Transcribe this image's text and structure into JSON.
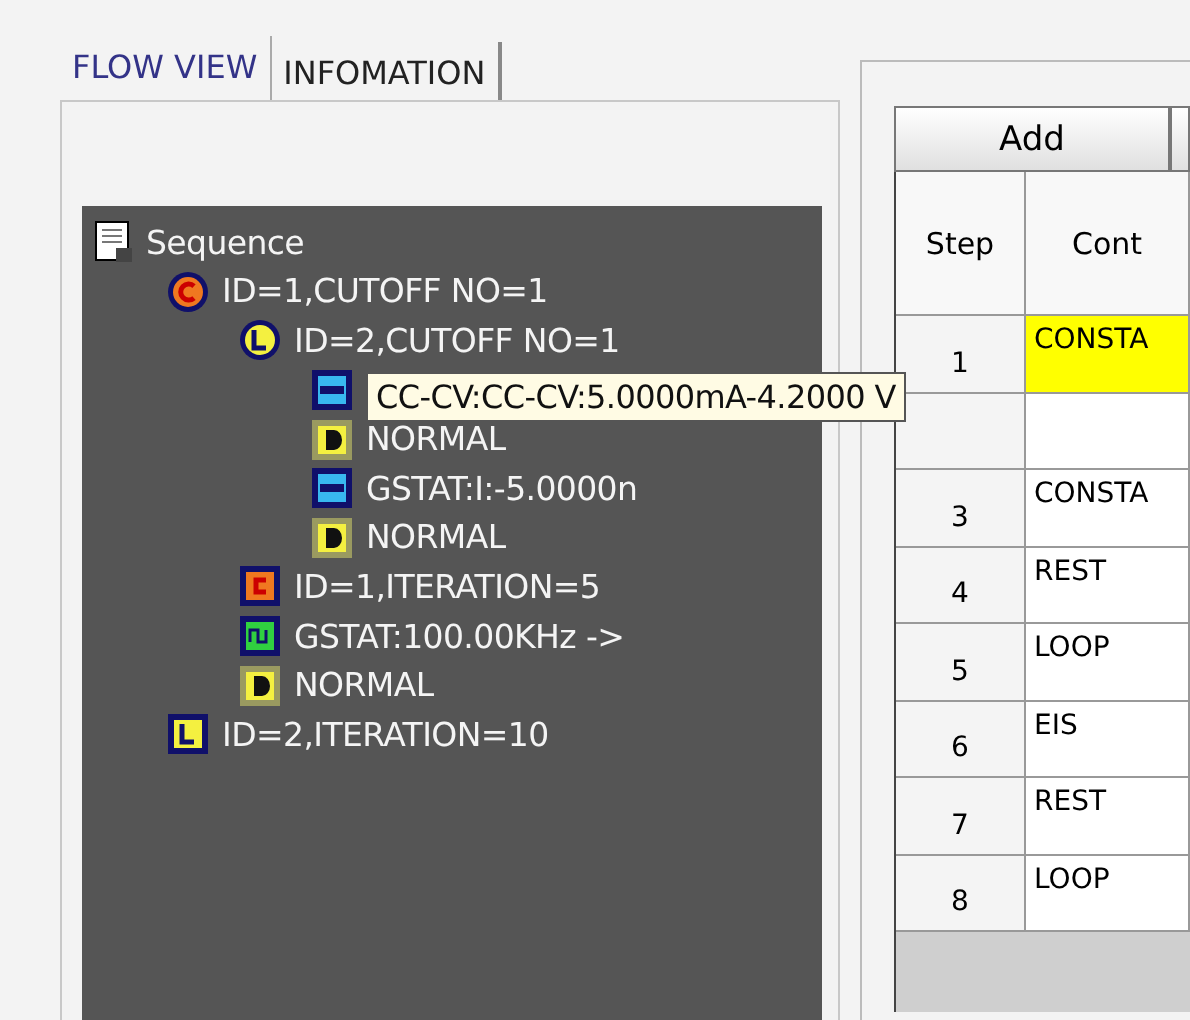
{
  "tabs": [
    {
      "label": "FLOW VIEW",
      "selected": true
    },
    {
      "label": "INFOMATION",
      "selected": false
    }
  ],
  "tree": [
    {
      "kind": "document",
      "label": "Sequence",
      "children": [
        {
          "kind": "cutoff",
          "label": "ID=1,CUTOFF NO=1",
          "children": [
            {
              "kind": "cutoff_loop",
              "label": "ID=2,CUTOFF NO=1",
              "children": [
                {
                  "kind": "step",
                  "label": "CC-CV:CC-CV:5.0000mA-4.2000 V",
                  "selected": true
                },
                {
                  "kind": "delay",
                  "label": "NORMAL",
                  "selected": false
                },
                {
                  "kind": "step",
                  "label": "GSTAT:I:-5.0000n",
                  "selected": false
                },
                {
                  "kind": "delay",
                  "label": "NORMAL",
                  "selected": false
                }
              ]
            },
            {
              "kind": "iteration_c",
              "label": "ID=1,ITERATION=5"
            },
            {
              "kind": "eis",
              "label": "GSTAT:100.00KHz ->"
            },
            {
              "kind": "delay",
              "label": "NORMAL"
            }
          ]
        },
        {
          "kind": "iteration_l",
          "label": "ID=2,ITERATION=10"
        }
      ]
    }
  ],
  "toolbar": [
    "Add"
  ],
  "table": {
    "columns": [
      "Step",
      "Cont"
    ],
    "rows": [
      {
        "step": "1",
        "content": "CONSTA",
        "selected": true
      },
      {
        "selected": false
      },
      {
        "step": "3",
        "content": "CONSTA",
        "selected": false
      },
      {
        "step": "4",
        "content": "REST",
        "selected": false
      },
      {
        "step": "5",
        "content": "LOOP",
        "selected": false
      },
      {
        "step": "6",
        "content": "EIS",
        "selected": false
      },
      {
        "step": "7",
        "content": "REST",
        "selected": false
      },
      {
        "step": "8",
        "content": "LOOP",
        "selected": false
      }
    ]
  }
}
